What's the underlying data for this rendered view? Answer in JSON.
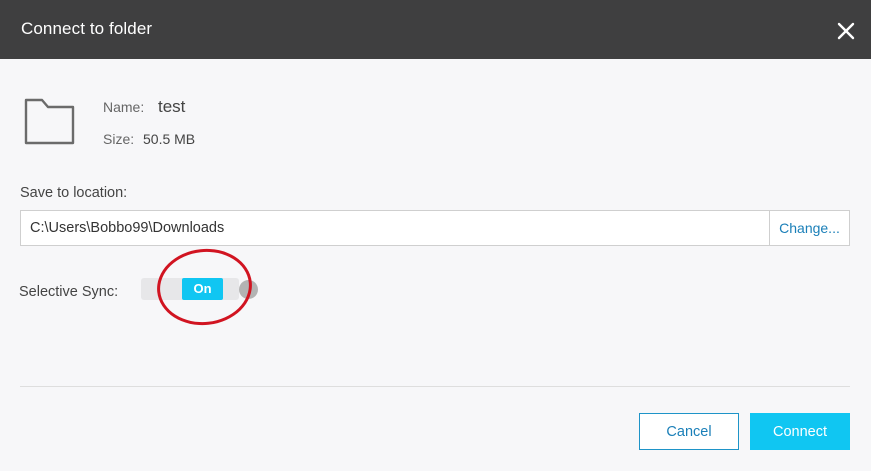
{
  "dialog": {
    "title": "Connect to folder",
    "close_icon": "close-icon"
  },
  "folder": {
    "icon": "folder-icon",
    "name_label": "Name:",
    "name_value": "test",
    "size_label": "Size:",
    "size_value": "50.5 MB"
  },
  "location": {
    "label": "Save to location:",
    "path": "C:\\Users\\Bobbo99\\Downloads",
    "change_label": "Change..."
  },
  "selective_sync": {
    "label": "Selective Sync:",
    "state_label": "On",
    "enabled": true
  },
  "footer": {
    "cancel_label": "Cancel",
    "connect_label": "Connect"
  },
  "colors": {
    "titlebar": "#3f3f40",
    "accent": "#10c6f2",
    "link": "#1a7fb8",
    "annotation": "#d11421"
  }
}
